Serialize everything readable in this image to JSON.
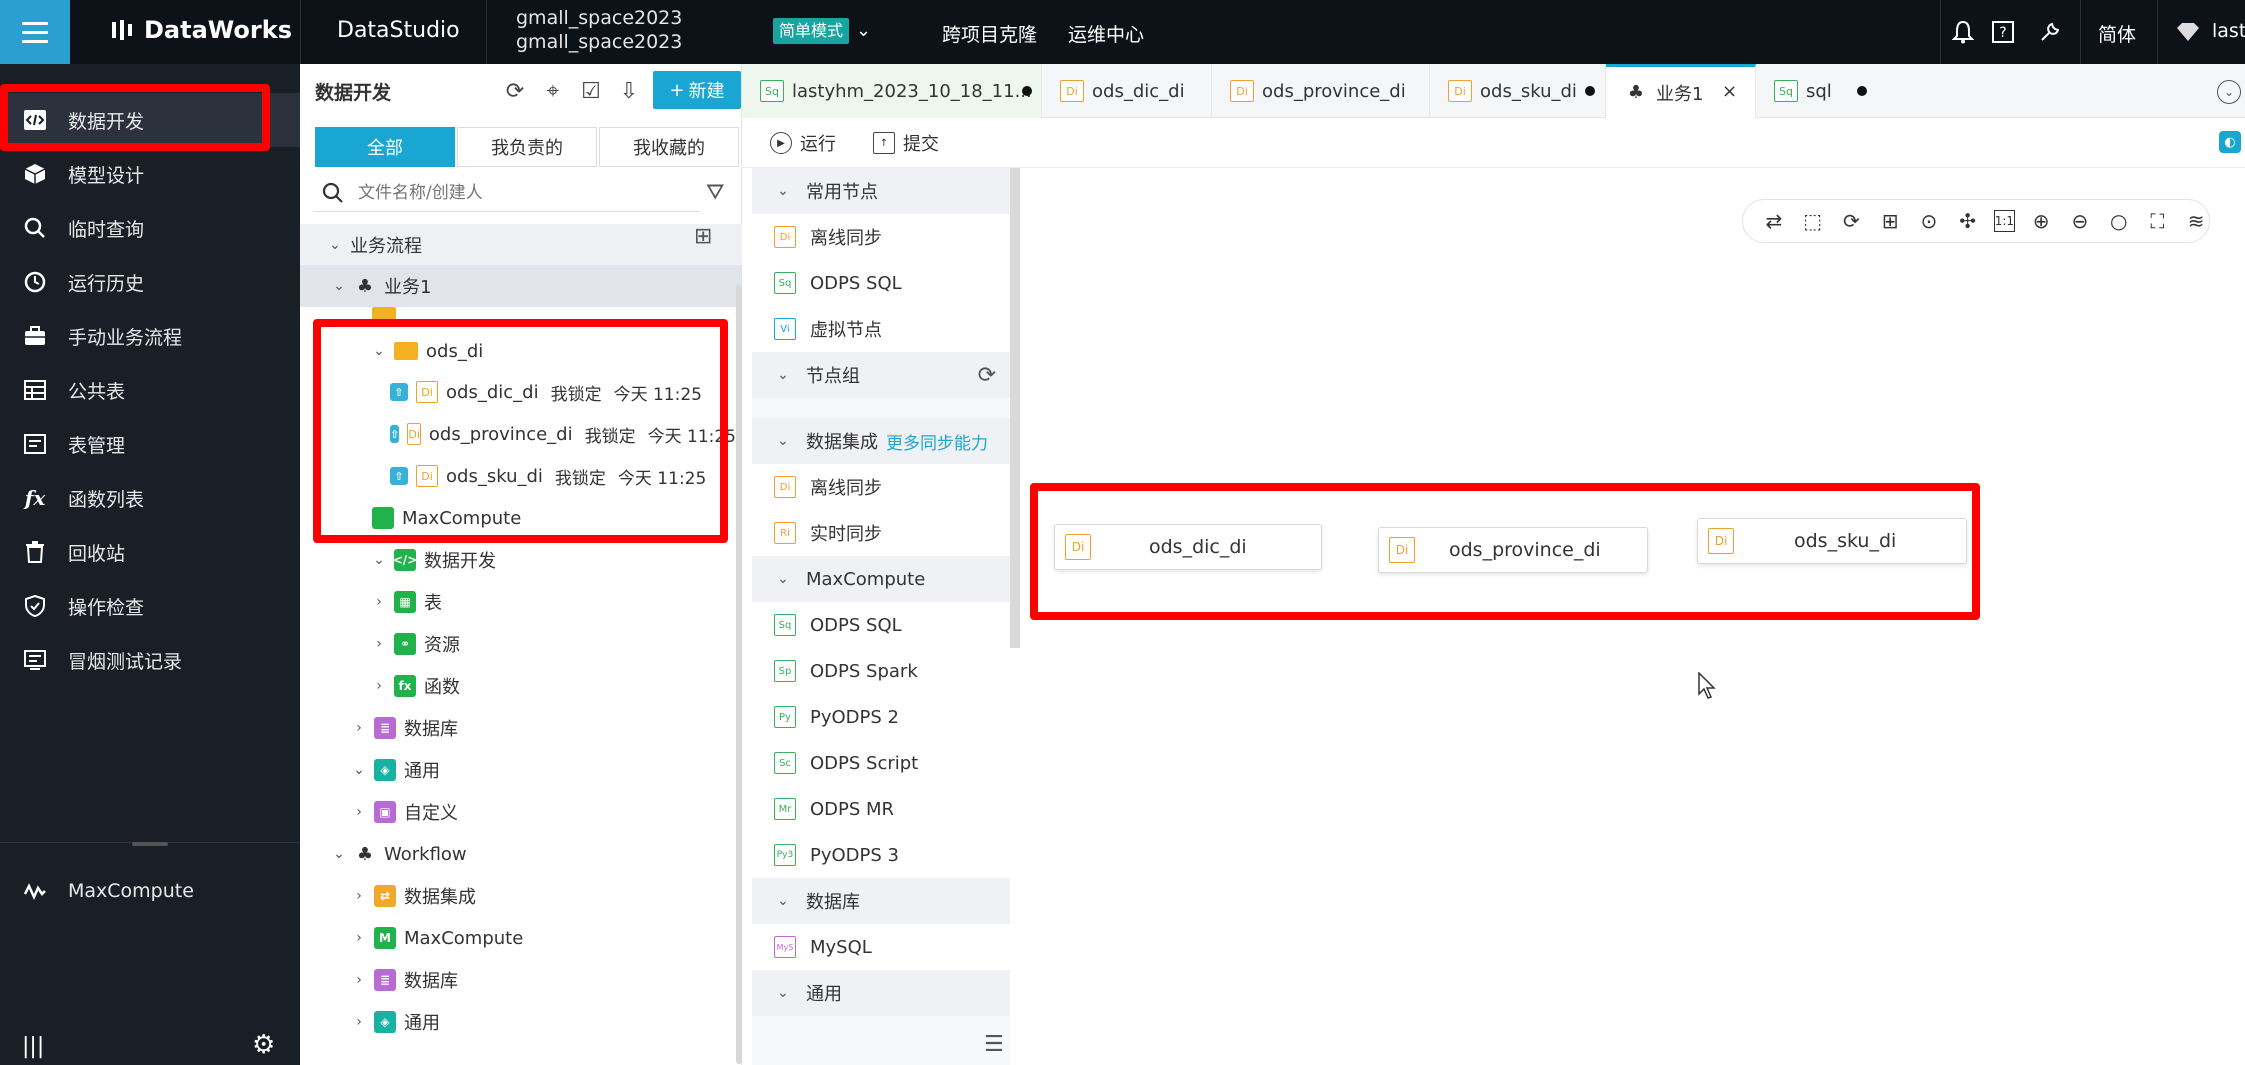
{
  "topbar": {
    "product": "DataWorks",
    "app": "DataStudio",
    "workspace_line1": "gmall_space2023",
    "workspace_line2": "gmall_space2023",
    "mode": "简单模式",
    "nav_clone": "跨项目克隆",
    "nav_ops": "运维中心",
    "lang": "简体",
    "user": "lasty"
  },
  "leftnav": {
    "items": [
      {
        "label": "数据开发",
        "icon": "code-icon"
      },
      {
        "label": "模型设计",
        "icon": "cube-icon"
      },
      {
        "label": "临时查询",
        "icon": "search-icon"
      },
      {
        "label": "运行历史",
        "icon": "clock-icon"
      },
      {
        "label": "手动业务流程",
        "icon": "briefcase-icon"
      },
      {
        "label": "公共表",
        "icon": "table-icon"
      },
      {
        "label": "表管理",
        "icon": "list-icon"
      },
      {
        "label": "函数列表",
        "icon": "fx-icon"
      },
      {
        "label": "回收站",
        "icon": "trash-icon"
      },
      {
        "label": "操作检查",
        "icon": "shield-icon"
      },
      {
        "label": "冒烟测试记录",
        "icon": "report-icon"
      }
    ],
    "maxcompute": "MaxCompute"
  },
  "tree": {
    "title": "数据开发",
    "new_button": "新建",
    "segments": [
      "全部",
      "我负责的",
      "我收藏的"
    ],
    "search_placeholder": "文件名称/创建人",
    "rows": {
      "business_flow": "业务流程",
      "biz1": "业务1",
      "folder_ods_di": "ods_di",
      "file1": "ods_dic_di",
      "file2": "ods_province_di",
      "file3": "ods_sku_di",
      "lock": "我锁定",
      "time": "今天 11:25",
      "maxcompute": "MaxCompute",
      "data_dev": "数据开发",
      "table": "表",
      "resource": "资源",
      "function": "函数",
      "database": "数据库",
      "general": "通用",
      "custom": "自定义",
      "workflow": "Workflow",
      "data_integration": "数据集成",
      "wf_maxcompute": "MaxCompute",
      "wf_database": "数据库",
      "wf_general": "通用"
    }
  },
  "tabs": [
    {
      "label": "lastyhm_2023_10_18_11...",
      "type": "Sq"
    },
    {
      "label": "ods_dic_di",
      "type": "Di"
    },
    {
      "label": "ods_province_di",
      "type": "Di"
    },
    {
      "label": "ods_sku_di",
      "type": "Di"
    },
    {
      "label": "业务1",
      "type": "flow"
    },
    {
      "label": "sql",
      "type": "Sq"
    }
  ],
  "actions": {
    "run": "运行",
    "submit": "提交"
  },
  "palette": {
    "common": "常用节点",
    "offline_sync": "离线同步",
    "odps_sql": "ODPS SQL",
    "virtual": "虚拟节点",
    "node_group": "节点组",
    "data_integration": "数据集成",
    "more_sync": "更多同步能力",
    "offline_sync2": "离线同步",
    "realtime_sync": "实时同步",
    "maxcompute": "MaxCompute",
    "mc_odps_sql": "ODPS SQL",
    "odps_spark": "ODPS Spark",
    "pyodps2": "PyODPS 2",
    "odps_script": "ODPS Script",
    "odps_mr": "ODPS MR",
    "pyodps3": "PyODPS 3",
    "database": "数据库",
    "mysql": "MySQL",
    "general": "通用"
  },
  "canvas": {
    "nodes": [
      {
        "label": "ods_dic_di",
        "type": "Di"
      },
      {
        "label": "ods_province_di",
        "type": "Di"
      },
      {
        "label": "ods_sku_di",
        "type": "Di"
      }
    ]
  },
  "icon_text": {
    "di": "Di",
    "sq": "Sq",
    "vi": "Vi",
    "ri": "Ri",
    "sp": "Sp",
    "py": "Py",
    "sc": "Sc",
    "mr": "Mr",
    "py3": "Py3",
    "my": "MyS",
    "one_to_one": "1:1"
  },
  "colors": {
    "accent": "#1aa6d3",
    "topbar": "#0d1118",
    "leftnav": "#1a1f27",
    "annotation": "#ff0000",
    "di_orange": "#f0a030",
    "sq_green": "#39b05a"
  }
}
